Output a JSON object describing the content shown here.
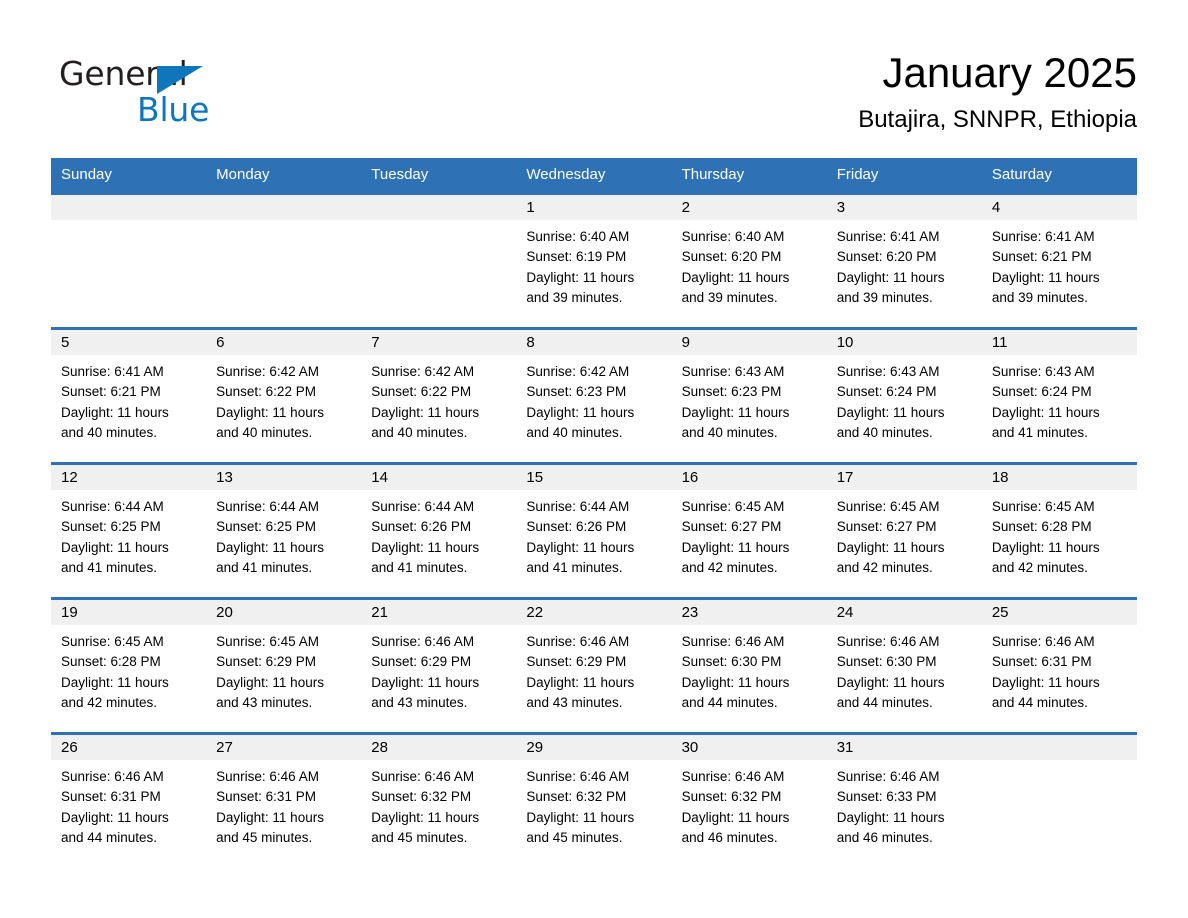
{
  "logo": {
    "word_one": "General",
    "word_two": "Blue",
    "triangle": "blue-triangle-icon",
    "color_black": "#231f20",
    "color_blue": "#1076bc"
  },
  "header": {
    "month_title": "January 2025",
    "location": "Butajira, SNNPR, Ethiopia"
  },
  "theme": {
    "header_blue": "#2e72b5",
    "day_band_grey": "#f0f0f0",
    "text_black": "#000000",
    "header_text": "#ffffff"
  },
  "weekdays": [
    "Sunday",
    "Monday",
    "Tuesday",
    "Wednesday",
    "Thursday",
    "Friday",
    "Saturday"
  ],
  "weeks": [
    [
      {
        "day": "",
        "sunrise": "",
        "sunset": "",
        "daylight_line1": "",
        "daylight_line2": ""
      },
      {
        "day": "",
        "sunrise": "",
        "sunset": "",
        "daylight_line1": "",
        "daylight_line2": ""
      },
      {
        "day": "",
        "sunrise": "",
        "sunset": "",
        "daylight_line1": "",
        "daylight_line2": ""
      },
      {
        "day": "1",
        "sunrise": "Sunrise: 6:40 AM",
        "sunset": "Sunset: 6:19 PM",
        "daylight_line1": "Daylight: 11 hours",
        "daylight_line2": "and 39 minutes."
      },
      {
        "day": "2",
        "sunrise": "Sunrise: 6:40 AM",
        "sunset": "Sunset: 6:20 PM",
        "daylight_line1": "Daylight: 11 hours",
        "daylight_line2": "and 39 minutes."
      },
      {
        "day": "3",
        "sunrise": "Sunrise: 6:41 AM",
        "sunset": "Sunset: 6:20 PM",
        "daylight_line1": "Daylight: 11 hours",
        "daylight_line2": "and 39 minutes."
      },
      {
        "day": "4",
        "sunrise": "Sunrise: 6:41 AM",
        "sunset": "Sunset: 6:21 PM",
        "daylight_line1": "Daylight: 11 hours",
        "daylight_line2": "and 39 minutes."
      }
    ],
    [
      {
        "day": "5",
        "sunrise": "Sunrise: 6:41 AM",
        "sunset": "Sunset: 6:21 PM",
        "daylight_line1": "Daylight: 11 hours",
        "daylight_line2": "and 40 minutes."
      },
      {
        "day": "6",
        "sunrise": "Sunrise: 6:42 AM",
        "sunset": "Sunset: 6:22 PM",
        "daylight_line1": "Daylight: 11 hours",
        "daylight_line2": "and 40 minutes."
      },
      {
        "day": "7",
        "sunrise": "Sunrise: 6:42 AM",
        "sunset": "Sunset: 6:22 PM",
        "daylight_line1": "Daylight: 11 hours",
        "daylight_line2": "and 40 minutes."
      },
      {
        "day": "8",
        "sunrise": "Sunrise: 6:42 AM",
        "sunset": "Sunset: 6:23 PM",
        "daylight_line1": "Daylight: 11 hours",
        "daylight_line2": "and 40 minutes."
      },
      {
        "day": "9",
        "sunrise": "Sunrise: 6:43 AM",
        "sunset": "Sunset: 6:23 PM",
        "daylight_line1": "Daylight: 11 hours",
        "daylight_line2": "and 40 minutes."
      },
      {
        "day": "10",
        "sunrise": "Sunrise: 6:43 AM",
        "sunset": "Sunset: 6:24 PM",
        "daylight_line1": "Daylight: 11 hours",
        "daylight_line2": "and 40 minutes."
      },
      {
        "day": "11",
        "sunrise": "Sunrise: 6:43 AM",
        "sunset": "Sunset: 6:24 PM",
        "daylight_line1": "Daylight: 11 hours",
        "daylight_line2": "and 41 minutes."
      }
    ],
    [
      {
        "day": "12",
        "sunrise": "Sunrise: 6:44 AM",
        "sunset": "Sunset: 6:25 PM",
        "daylight_line1": "Daylight: 11 hours",
        "daylight_line2": "and 41 minutes."
      },
      {
        "day": "13",
        "sunrise": "Sunrise: 6:44 AM",
        "sunset": "Sunset: 6:25 PM",
        "daylight_line1": "Daylight: 11 hours",
        "daylight_line2": "and 41 minutes."
      },
      {
        "day": "14",
        "sunrise": "Sunrise: 6:44 AM",
        "sunset": "Sunset: 6:26 PM",
        "daylight_line1": "Daylight: 11 hours",
        "daylight_line2": "and 41 minutes."
      },
      {
        "day": "15",
        "sunrise": "Sunrise: 6:44 AM",
        "sunset": "Sunset: 6:26 PM",
        "daylight_line1": "Daylight: 11 hours",
        "daylight_line2": "and 41 minutes."
      },
      {
        "day": "16",
        "sunrise": "Sunrise: 6:45 AM",
        "sunset": "Sunset: 6:27 PM",
        "daylight_line1": "Daylight: 11 hours",
        "daylight_line2": "and 42 minutes."
      },
      {
        "day": "17",
        "sunrise": "Sunrise: 6:45 AM",
        "sunset": "Sunset: 6:27 PM",
        "daylight_line1": "Daylight: 11 hours",
        "daylight_line2": "and 42 minutes."
      },
      {
        "day": "18",
        "sunrise": "Sunrise: 6:45 AM",
        "sunset": "Sunset: 6:28 PM",
        "daylight_line1": "Daylight: 11 hours",
        "daylight_line2": "and 42 minutes."
      }
    ],
    [
      {
        "day": "19",
        "sunrise": "Sunrise: 6:45 AM",
        "sunset": "Sunset: 6:28 PM",
        "daylight_line1": "Daylight: 11 hours",
        "daylight_line2": "and 42 minutes."
      },
      {
        "day": "20",
        "sunrise": "Sunrise: 6:45 AM",
        "sunset": "Sunset: 6:29 PM",
        "daylight_line1": "Daylight: 11 hours",
        "daylight_line2": "and 43 minutes."
      },
      {
        "day": "21",
        "sunrise": "Sunrise: 6:46 AM",
        "sunset": "Sunset: 6:29 PM",
        "daylight_line1": "Daylight: 11 hours",
        "daylight_line2": "and 43 minutes."
      },
      {
        "day": "22",
        "sunrise": "Sunrise: 6:46 AM",
        "sunset": "Sunset: 6:29 PM",
        "daylight_line1": "Daylight: 11 hours",
        "daylight_line2": "and 43 minutes."
      },
      {
        "day": "23",
        "sunrise": "Sunrise: 6:46 AM",
        "sunset": "Sunset: 6:30 PM",
        "daylight_line1": "Daylight: 11 hours",
        "daylight_line2": "and 44 minutes."
      },
      {
        "day": "24",
        "sunrise": "Sunrise: 6:46 AM",
        "sunset": "Sunset: 6:30 PM",
        "daylight_line1": "Daylight: 11 hours",
        "daylight_line2": "and 44 minutes."
      },
      {
        "day": "25",
        "sunrise": "Sunrise: 6:46 AM",
        "sunset": "Sunset: 6:31 PM",
        "daylight_line1": "Daylight: 11 hours",
        "daylight_line2": "and 44 minutes."
      }
    ],
    [
      {
        "day": "26",
        "sunrise": "Sunrise: 6:46 AM",
        "sunset": "Sunset: 6:31 PM",
        "daylight_line1": "Daylight: 11 hours",
        "daylight_line2": "and 44 minutes."
      },
      {
        "day": "27",
        "sunrise": "Sunrise: 6:46 AM",
        "sunset": "Sunset: 6:31 PM",
        "daylight_line1": "Daylight: 11 hours",
        "daylight_line2": "and 45 minutes."
      },
      {
        "day": "28",
        "sunrise": "Sunrise: 6:46 AM",
        "sunset": "Sunset: 6:32 PM",
        "daylight_line1": "Daylight: 11 hours",
        "daylight_line2": "and 45 minutes."
      },
      {
        "day": "29",
        "sunrise": "Sunrise: 6:46 AM",
        "sunset": "Sunset: 6:32 PM",
        "daylight_line1": "Daylight: 11 hours",
        "daylight_line2": "and 45 minutes."
      },
      {
        "day": "30",
        "sunrise": "Sunrise: 6:46 AM",
        "sunset": "Sunset: 6:32 PM",
        "daylight_line1": "Daylight: 11 hours",
        "daylight_line2": "and 46 minutes."
      },
      {
        "day": "31",
        "sunrise": "Sunrise: 6:46 AM",
        "sunset": "Sunset: 6:33 PM",
        "daylight_line1": "Daylight: 11 hours",
        "daylight_line2": "and 46 minutes."
      },
      {
        "day": "",
        "sunrise": "",
        "sunset": "",
        "daylight_line1": "",
        "daylight_line2": ""
      }
    ]
  ]
}
